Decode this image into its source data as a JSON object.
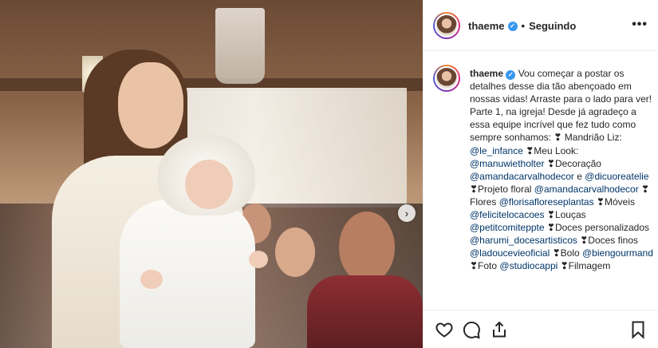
{
  "post": {
    "username": "thaeme",
    "separator": "•",
    "follow_status": "Seguindo",
    "more_label": "•••",
    "carousel_next_label": "›"
  },
  "caption": {
    "username": "thaeme",
    "segments": [
      {
        "text": "Vou começar a postar os detalhes desse dia tão abençoado em nossas vidas! Arraste para o lado para ver! Parte 1, na igreja! Desde já agradeço a essa equipe incrível que fez tudo como sempre sonhamos: ❣ Mandrião Liz: ",
        "mention": false
      },
      {
        "text": "@le_infance",
        "mention": true
      },
      {
        "text": " ❣Meu Look: ",
        "mention": false
      },
      {
        "text": "@manuwietholter",
        "mention": true
      },
      {
        "text": " ❣Decoração ",
        "mention": false
      },
      {
        "text": "@amandacarvalhodecor",
        "mention": true
      },
      {
        "text": " e ",
        "mention": false
      },
      {
        "text": "@dicuoreatelie",
        "mention": true
      },
      {
        "text": " ❣Projeto floral ",
        "mention": false
      },
      {
        "text": "@amandacarvalhodecor",
        "mention": true
      },
      {
        "text": " ❣Flores ",
        "mention": false
      },
      {
        "text": "@florisafloreseplantas",
        "mention": true
      },
      {
        "text": " ❣Móveis ",
        "mention": false
      },
      {
        "text": "@felicitelocacoes",
        "mention": true
      },
      {
        "text": " ❣Louças ",
        "mention": false
      },
      {
        "text": "@petitcomiteppte",
        "mention": true
      },
      {
        "text": " ❣Doces personalizados ",
        "mention": false
      },
      {
        "text": "@harumi_docesartisticos",
        "mention": true
      },
      {
        "text": " ❣Doces finos ",
        "mention": false
      },
      {
        "text": "@ladoucevieoficial",
        "mention": true
      },
      {
        "text": " ❣Bolo ",
        "mention": false
      },
      {
        "text": "@biengourmand",
        "mention": true
      },
      {
        "text": " ❣Foto ",
        "mention": false
      },
      {
        "text": "@studiocappi",
        "mention": true
      },
      {
        "text": " ❣Filmagem",
        "mention": false
      }
    ]
  },
  "icons": {
    "verified": "verified-badge-icon",
    "like": "heart-icon",
    "comment": "comment-bubble-icon",
    "share": "share-icon",
    "save": "bookmark-icon"
  },
  "colors": {
    "verified": "#3897f0",
    "mention": "#003569",
    "text": "#262626",
    "border": "#efefef"
  }
}
